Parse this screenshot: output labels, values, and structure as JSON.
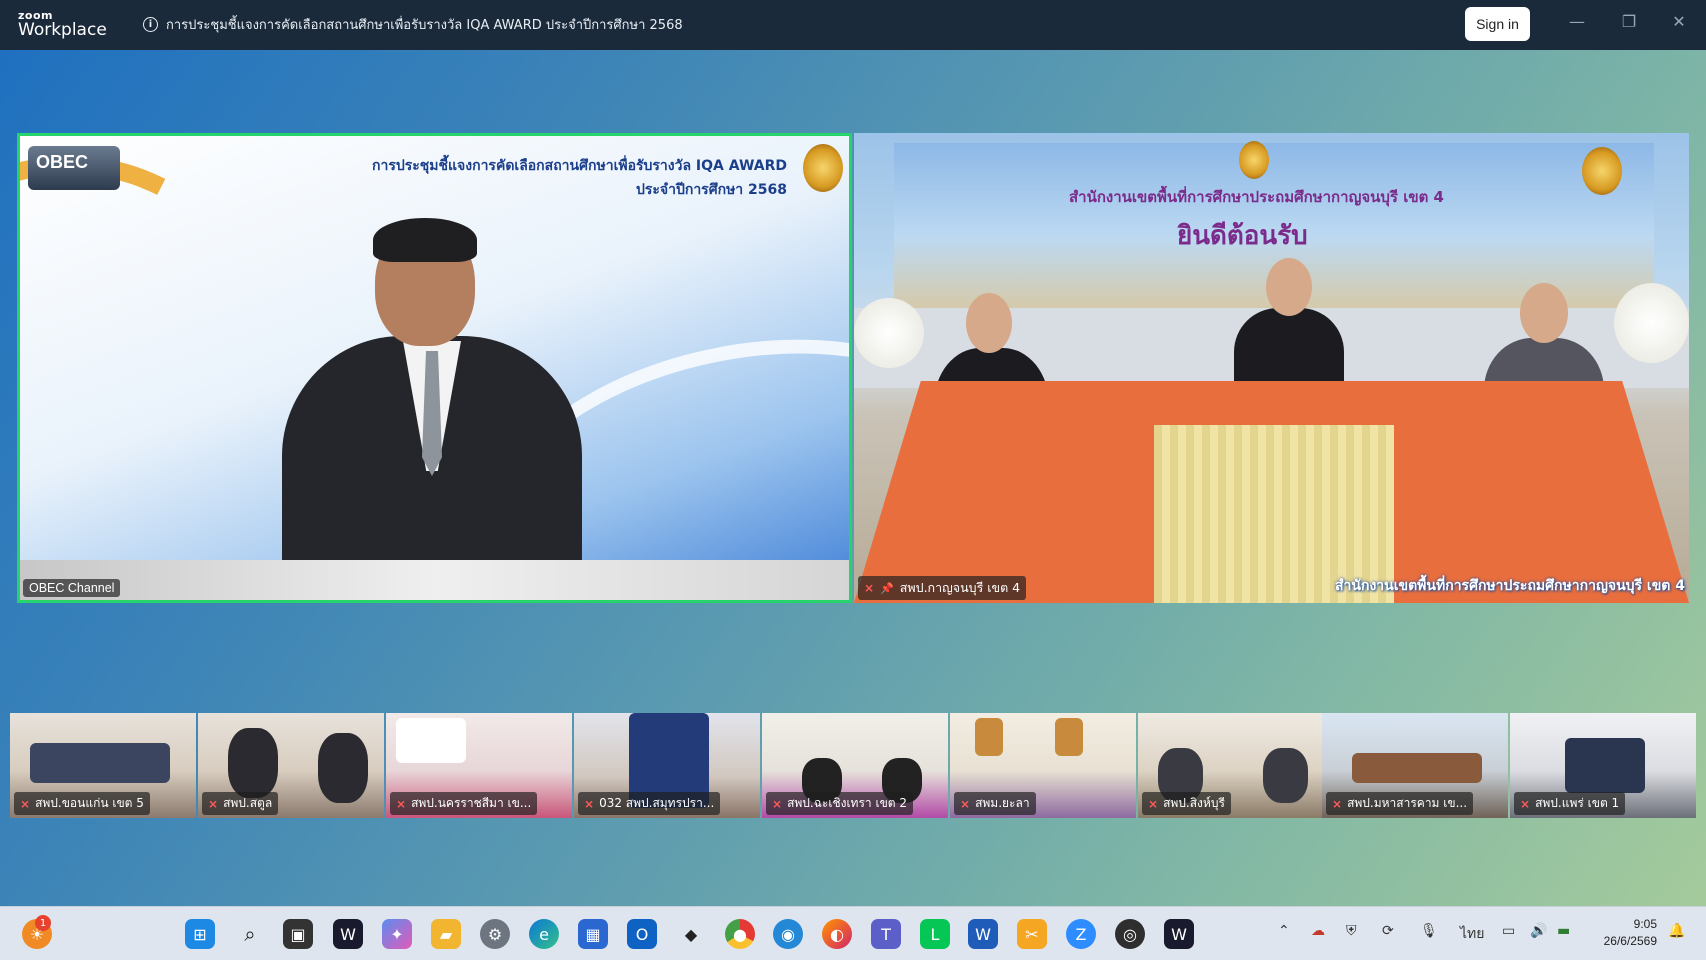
{
  "titlebar": {
    "brand_small": "zoom",
    "brand_large": "Workplace",
    "meeting_title": "การประชุมชี้แจงการคัดเลือกสถานศึกษาเพื่อรับรางวัล IQA AWARD ประจำปีการศึกษา 2568",
    "sign_in_label": "Sign in",
    "minimize_glyph": "—",
    "restore_glyph": "❐",
    "close_glyph": "✕"
  },
  "main_left": {
    "participant_name": "OBEC Channel",
    "logo_text": "OBEC",
    "slide_line1": "การประชุมชี้แจงการคัดเลือกสถานศึกษาเพื่อรับรางวัล IQA AWARD",
    "slide_line2": "ประจำปีการศึกษา 2568"
  },
  "main_right": {
    "participant_name": "สพป.กาญจนบุรี เขต 4",
    "muted": true,
    "pinned": true,
    "banner_line1": "สำนักงานเขตพื้นที่การศึกษาประถมศึกษากาญจนบุรี เขต 4",
    "banner_line2": "ยินดีต้อนรับ",
    "bottom_caption": "สำนักงานเขตพื้นที่การศึกษาประถมศึกษากาญจนบุรี เขต 4"
  },
  "thumbnails": [
    {
      "name": "สพป.ขอนแก่น เขต 5",
      "muted": true
    },
    {
      "name": "สพป.สตูล",
      "muted": true
    },
    {
      "name": "สพป.นครราชสีมา เข...",
      "muted": true
    },
    {
      "name": "032 สพป.สมุทรปรา...",
      "muted": true
    },
    {
      "name": "สพป.ฉะเชิงเทรา เขต 2",
      "muted": true
    },
    {
      "name": "สพม.ยะลา",
      "muted": true
    },
    {
      "name": "สพป.สิงห์บุรี",
      "muted": true
    },
    {
      "name": "สพป.มหาสารคาม เข...",
      "muted": true
    },
    {
      "name": "สพป.แพร่ เขต 1",
      "muted": true
    }
  ],
  "taskbar": {
    "notification_badge": "1",
    "language": "ไทย",
    "time": "9:05",
    "date": "26/6/2569",
    "icons": [
      "widgets-icon",
      "windows-start-icon",
      "search-icon",
      "task-view-icon",
      "webex-icon",
      "copilot-icon",
      "file-explorer-icon",
      "settings-icon",
      "edge-icon",
      "store-icon",
      "outlook-icon",
      "dropbox-icon",
      "chrome-icon",
      "camera-icon",
      "firefox-icon",
      "teams-icon",
      "line-icon",
      "word-icon",
      "snipping-tool-icon",
      "zoom-icon",
      "obs-icon",
      "webex-meetings-icon"
    ]
  },
  "colors": {
    "active_speaker_border": "#27d36b",
    "titlebar_bg": "#1b2a3a",
    "muted_red": "#ff5a5a"
  }
}
